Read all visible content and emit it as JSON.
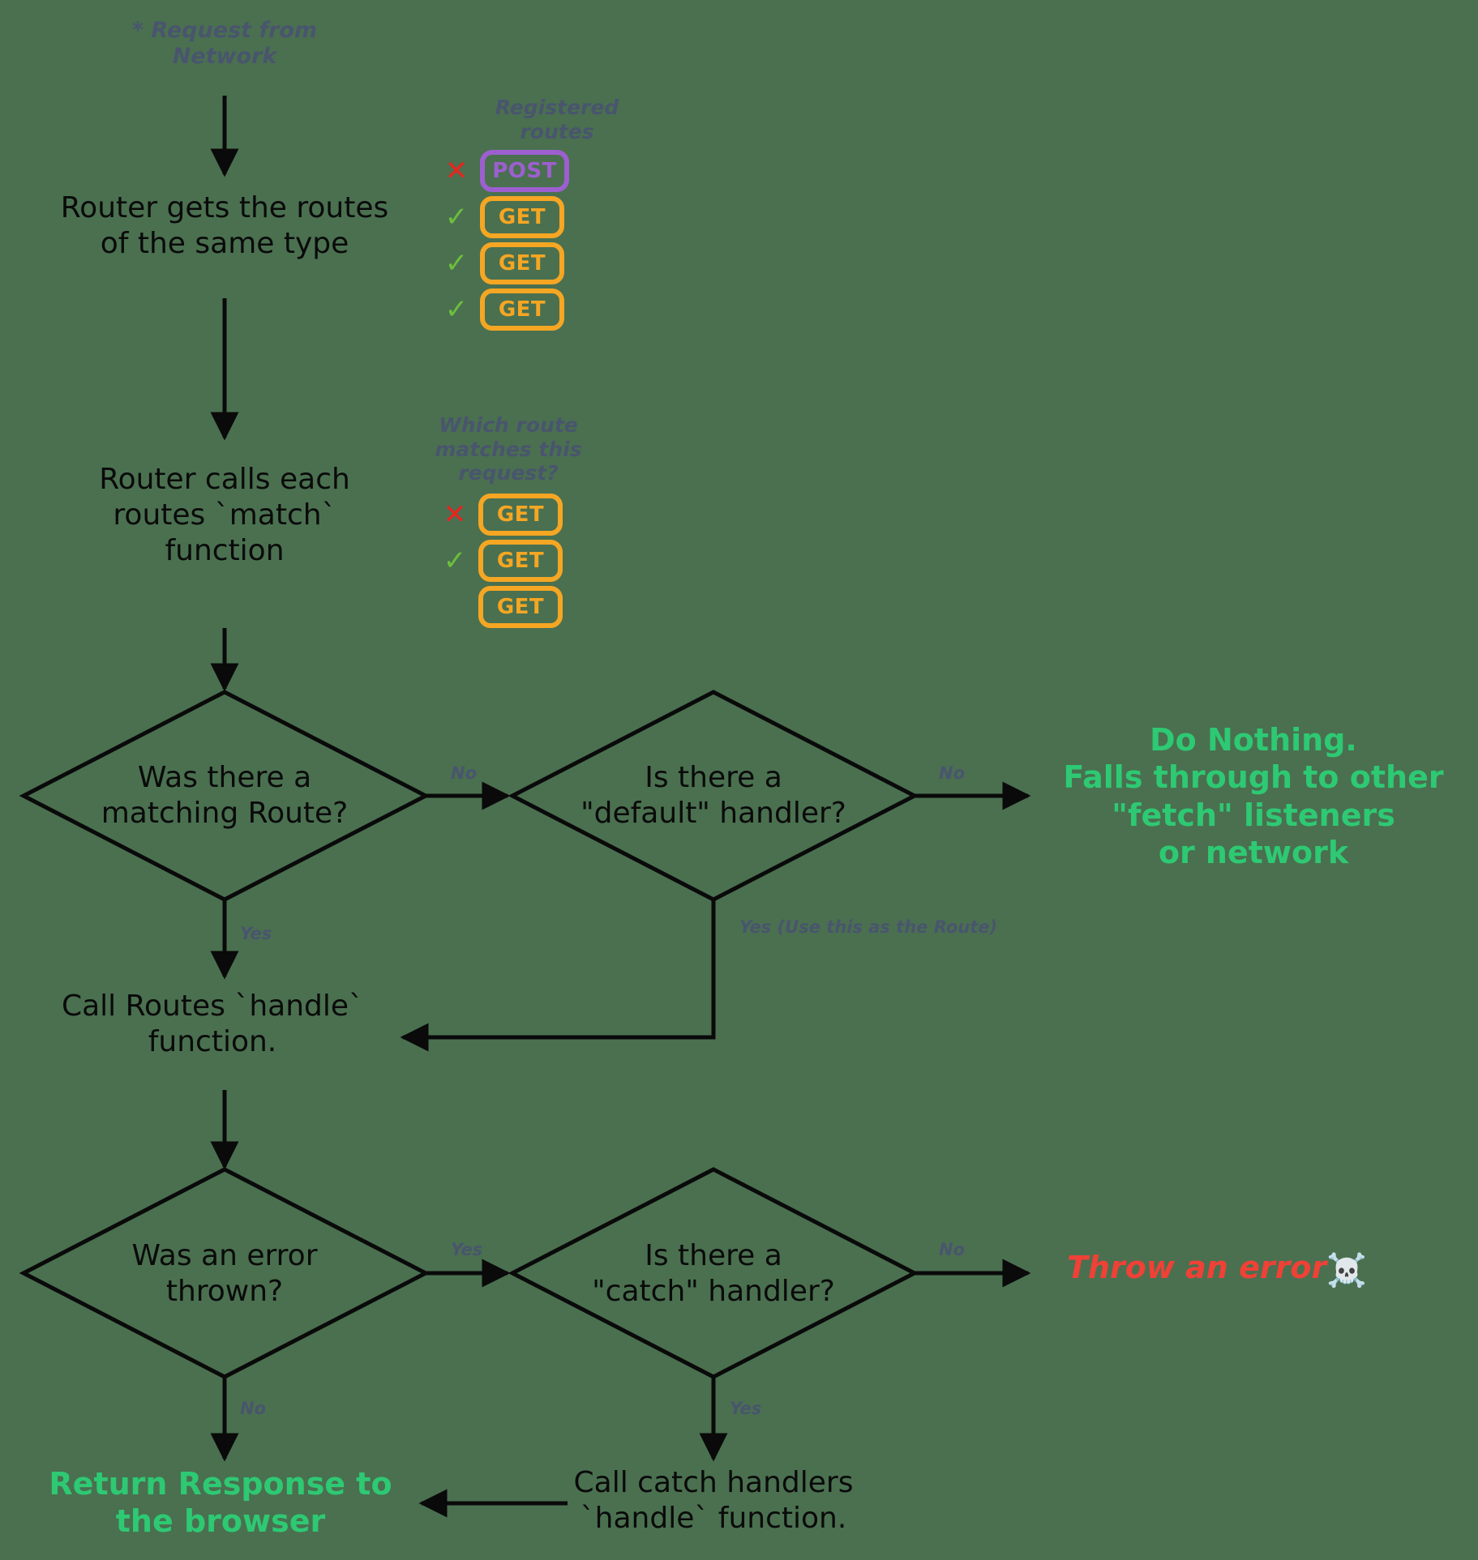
{
  "diagram": {
    "title": "Workbox Router request handling flow",
    "background_color": "#4a7050",
    "accent_colors": {
      "get_badge": "#f5a623",
      "post_badge": "#9d5fd0",
      "check": "#6cbe3c",
      "cross": "#e8241f",
      "success_text": "#2ec973",
      "error_text": "#ef4136",
      "edge_label": "#49556d",
      "node_text": "#0a0a0a"
    }
  },
  "nodes": {
    "start_note": "* Request from\nNetwork",
    "router_gets_routes": "Router gets the routes\nof the same type",
    "router_calls_match": "Router calls each\nroutes `match`\nfunction",
    "decision_matching_route": "Was there a\nmatching Route?",
    "decision_default_handler": "Is there a\n\"default\" handler?",
    "call_routes_handle": "Call Routes `handle`\nfunction.",
    "decision_error_thrown": "Was an error\nthrown?",
    "decision_catch_handler": "Is there a\n\"catch\" handler?",
    "call_catch_handlers": "Call catch handlers\n`handle` function.",
    "do_nothing": "Do Nothing.\nFalls through to other\n\"fetch\" listeners\nor network",
    "throw_error": "Throw an error",
    "throw_error_emoji": "☠️",
    "return_response": "Return Response to\nthe browser"
  },
  "edge_labels": {
    "matching_route_no": "No",
    "matching_route_yes": "Yes",
    "default_handler_no": "No",
    "default_handler_yes": "Yes (Use this as the Route)",
    "error_thrown_yes": "Yes",
    "error_thrown_no": "No",
    "catch_handler_no": "No",
    "catch_handler_yes": "Yes"
  },
  "route_groups": [
    {
      "id": "registered-routes",
      "caption": "Registered\nroutes",
      "rows": [
        {
          "mark": "cross",
          "mark_glyph": "✕",
          "method": "POST"
        },
        {
          "mark": "check",
          "mark_glyph": "✓",
          "method": "GET"
        },
        {
          "mark": "check",
          "mark_glyph": "✓",
          "method": "GET"
        },
        {
          "mark": "check",
          "mark_glyph": "✓",
          "method": "GET"
        }
      ]
    },
    {
      "id": "matching-routes",
      "caption": "Which route\nmatches this request?",
      "rows": [
        {
          "mark": "cross",
          "mark_glyph": "✕",
          "method": "GET"
        },
        {
          "mark": "check",
          "mark_glyph": "✓",
          "method": "GET"
        },
        {
          "mark": "blank",
          "mark_glyph": "",
          "method": "GET"
        }
      ]
    }
  ]
}
